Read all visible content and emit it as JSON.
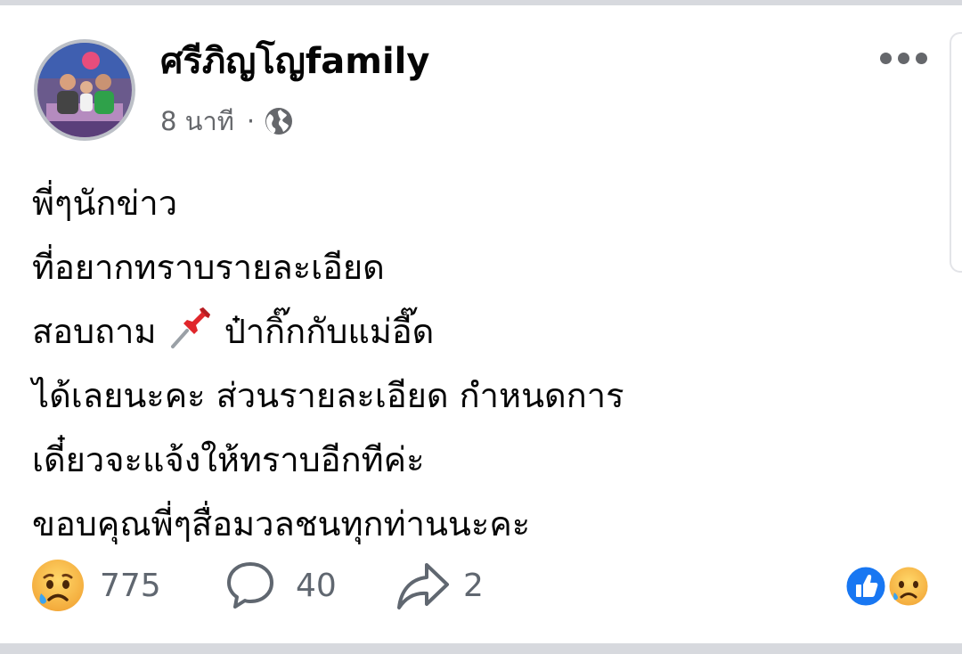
{
  "post": {
    "page_name": "ศรีภิญโญfamily",
    "time": "8 นาที",
    "separator": "·",
    "privacy_icon": "globe-icon",
    "menu_icon": "more-horizontal-icon",
    "lines": [
      "พี่ๆนักข่าว",
      "ที่อยากทราบรายละเอียด",
      "ได้เลยนะคะ ส่วนรายละเอียด กำหนดการ",
      "เดี๋ยวจะแจ้งให้ทราบอีกทีค่ะ",
      "ขอบคุณพี่ๆสื่อมวลชนทุกท่านนะคะ"
    ],
    "line3_before": "สอบถาม",
    "line3_after": "ป๋ากิ๊กกับแม่อี๊ด",
    "pin_emoji": "pushpin-icon"
  },
  "stats": {
    "reaction_count": "775",
    "comment_count": "40",
    "share_count": "2",
    "reaction_icon": "sad-face-icon",
    "comment_icon": "comment-icon",
    "share_icon": "share-icon",
    "summary_icons": [
      "like-icon",
      "sad-face-icon"
    ]
  },
  "colors": {
    "name_text": "#050505",
    "secondary_text": "#65676b",
    "like_blue": "#1877f2",
    "sad_yellow": "#f5b73b"
  }
}
